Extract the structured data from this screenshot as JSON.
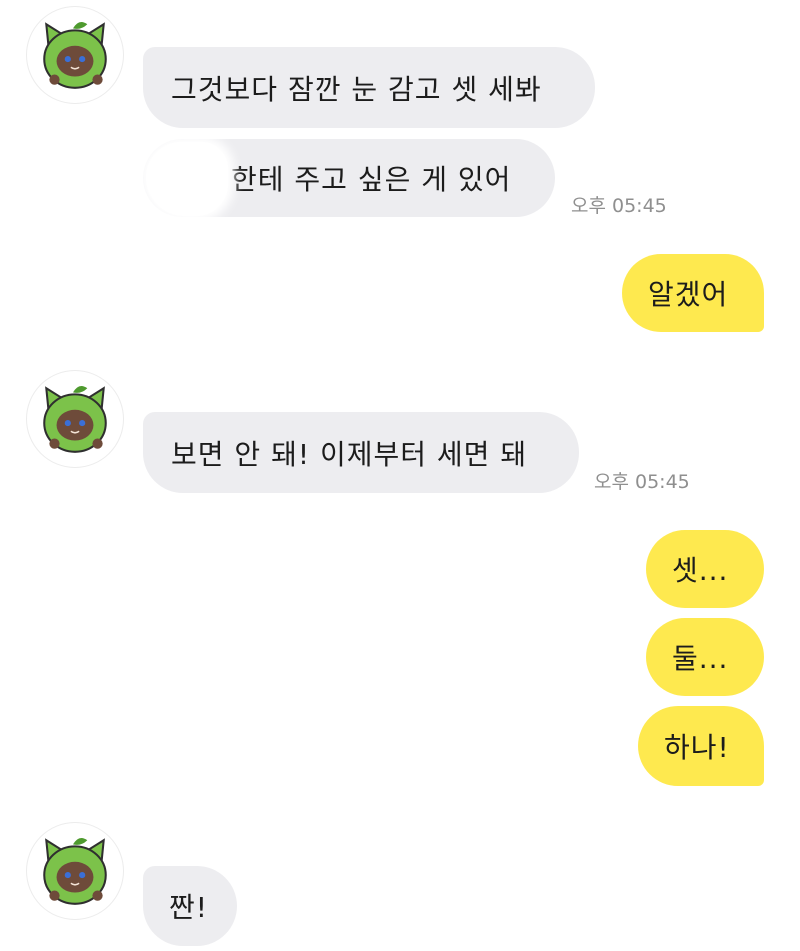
{
  "messages": {
    "m1": {
      "text": "그것보다 잠깐 눈 감고 셋 세봐"
    },
    "m2": {
      "text": "한테 주고 싶은 게 있어",
      "time": "오후 05:45"
    },
    "m3": {
      "text": "알겠어"
    },
    "m4": {
      "text": "보면 안 돼! 이제부터 세면 돼",
      "time": "오후 05:45"
    },
    "m5": {
      "text": "셋..."
    },
    "m6": {
      "text": "둘..."
    },
    "m7": {
      "text": "하나!"
    },
    "m8": {
      "text": "짠!"
    }
  },
  "colors": {
    "incoming_bubble": "#ededf0",
    "outgoing_bubble": "#fee94f",
    "avatar_body": "#7cc24a",
    "avatar_face": "#6e4b3a"
  },
  "icons": {
    "avatar": "green-cat-avatar-icon"
  }
}
